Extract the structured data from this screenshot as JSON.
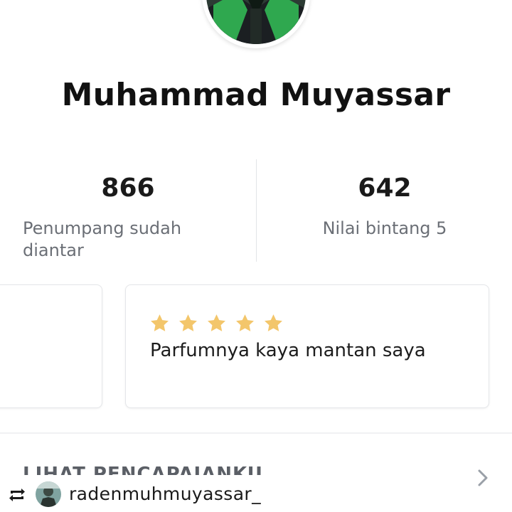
{
  "profile": {
    "name": "Muhammad Muyassar"
  },
  "stats": [
    {
      "value": "866",
      "label_line1": "Penumpang sudah",
      "label_line2": "diantar"
    },
    {
      "value": "642",
      "label": "Nilai bintang 5"
    }
  ],
  "review": {
    "stars": 5,
    "text": "Parfumnya kaya mantan saya"
  },
  "achievements": {
    "label": "LIHAT PENCAPAIANKU"
  },
  "repost": {
    "username": "radenmuhmuyassar_"
  },
  "colors": {
    "star": "#f3c66b",
    "brand_green": "#2fa84f",
    "muted_text": "#6b6f76",
    "divider": "#e2e4e7"
  },
  "icons": [
    "star-icon",
    "chevron-right-icon",
    "repost-icon"
  ]
}
